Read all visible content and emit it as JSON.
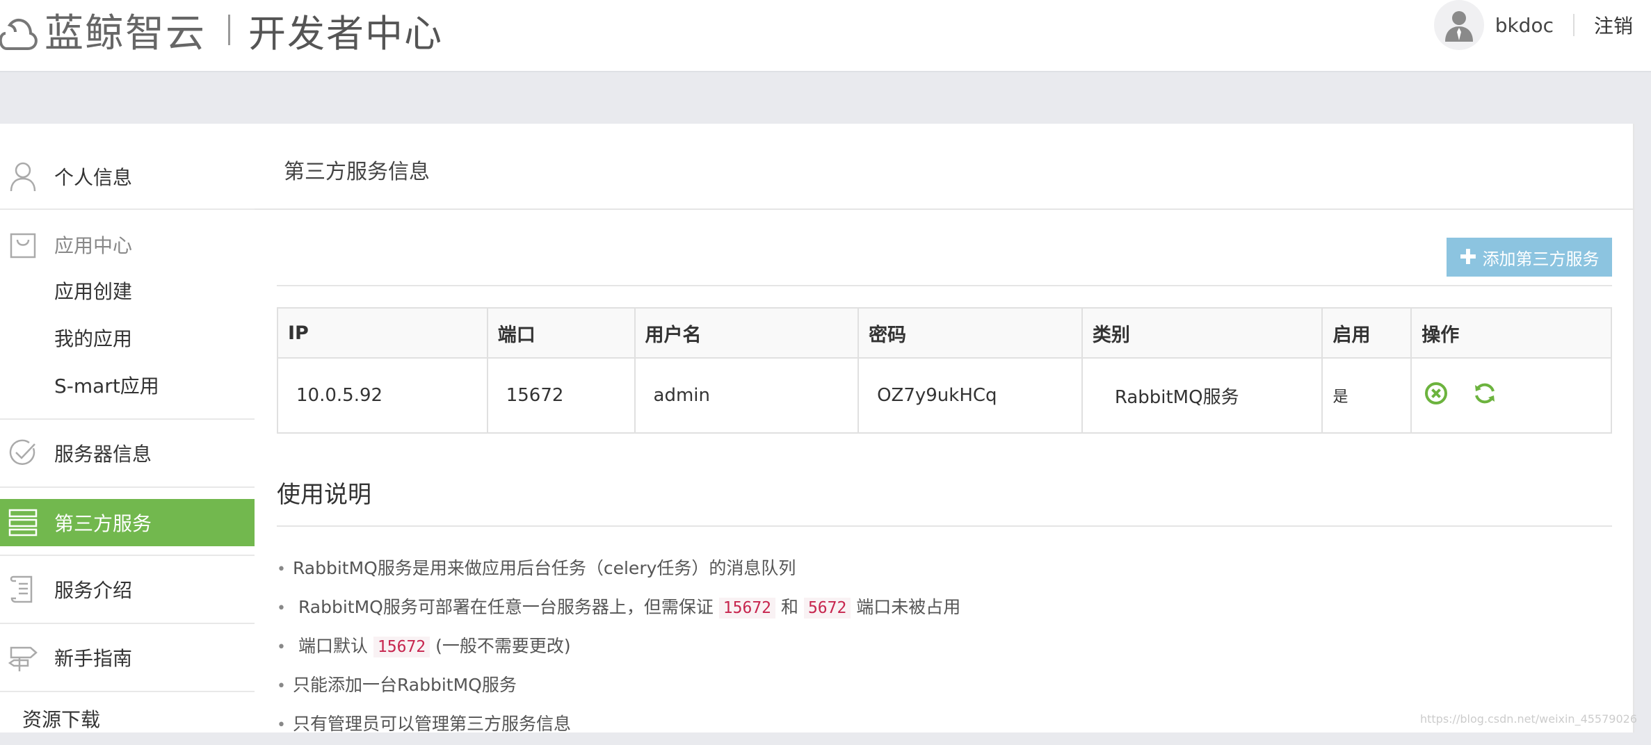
{
  "header": {
    "brand": "蓝鲸智云",
    "subtitle": "开发者中心",
    "username": "bkdoc",
    "logout": "注销"
  },
  "sidebar": {
    "personal_info": "个人信息",
    "app_center": "应用中心",
    "app_create": "应用创建",
    "my_apps": "我的应用",
    "smart_apps": "S-mart应用",
    "server_info": "服务器信息",
    "third_party": "第三方服务",
    "service_intro": "服务介绍",
    "guide": "新手指南",
    "download": "资源下载"
  },
  "main": {
    "title": "第三方服务信息",
    "add_button": "添加第三方服务",
    "table": {
      "headers": [
        "IP",
        "端口",
        "用户名",
        "密码",
        "类别",
        "启用",
        "操作"
      ],
      "rows": [
        {
          "ip": "10.0.5.92",
          "port": "15672",
          "user": "admin",
          "password": "OZ7y9ukHCq",
          "category": "RabbitMQ服务",
          "enabled": "是"
        }
      ]
    },
    "usage_title": "使用说明",
    "notes": {
      "n1": "RabbitMQ服务是用来做应用后台任务（celery任务）的消息队列",
      "n2a": "RabbitMQ服务可部署在任意一台服务器上，但需保证",
      "n2code1": "15672",
      "n2b": "和",
      "n2code2": "5672",
      "n2c": "端口未被占用",
      "n3a": "端口默认",
      "n3code": "15672",
      "n3b": "(一般不需要更改)",
      "n4": "只能添加一台RabbitMQ服务",
      "n5": "只有管理员可以管理第三方服务信息"
    }
  },
  "watermark": "https://blog.csdn.net/weixin_45579026",
  "colors": {
    "active": "#72b84e",
    "button": "#8cc4e0",
    "ok_icon": "#6cb33e",
    "code": "#c7254e"
  }
}
